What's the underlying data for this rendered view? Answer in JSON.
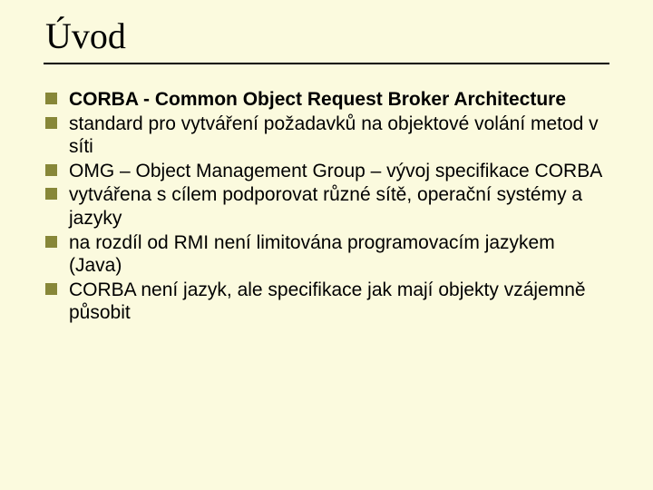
{
  "title": "Úvod",
  "bullets": [
    {
      "bold": "CORBA  - Common Object Request Broker Architecture",
      "rest": ""
    },
    {
      "bold": "",
      "rest": "standard pro vytváření požadavků na objektové volání metod v síti"
    },
    {
      "bold": "",
      "rest": "OMG – Object Management Group – vývoj specifikace CORBA"
    },
    {
      "bold": "",
      "rest": "vytvářena s cílem podporovat různé sítě, operační systémy a jazyky"
    },
    {
      "bold": "",
      "rest": "na rozdíl od RMI není limitována programovacím jazykem (Java)"
    },
    {
      "bold": "",
      "rest": "CORBA není jazyk, ale specifikace jak mají objekty vzájemně působit"
    }
  ]
}
